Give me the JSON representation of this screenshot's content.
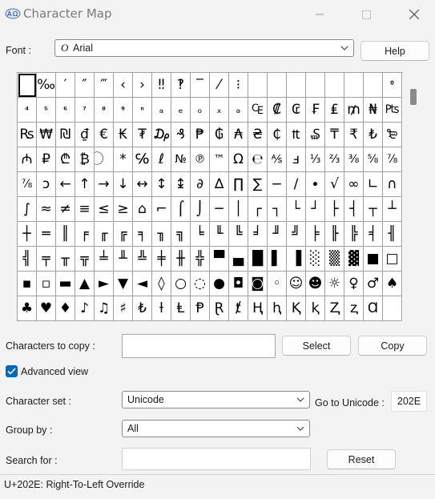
{
  "window": {
    "title": "Character Map"
  },
  "font": {
    "label": "Font :",
    "value": "Arial",
    "icon_glyph": "O"
  },
  "buttons": {
    "help": "Help",
    "select": "Select",
    "copy": "Copy",
    "reset": "Reset"
  },
  "copy_field": {
    "label": "Characters to copy :",
    "value": ""
  },
  "advanced": {
    "label": "Advanced view",
    "checked": true
  },
  "charset": {
    "label": "Character set :",
    "value": "Unicode"
  },
  "goto_unicode": {
    "label": "Go to Unicode :",
    "value": "202E"
  },
  "group_by": {
    "label": "Group by :",
    "value": "All"
  },
  "search": {
    "label": "Search for :",
    "value": ""
  },
  "status": "U+202E: Right-To-Left Override",
  "grid_rows": [
    [
      "",
      "‰",
      "′",
      "″",
      "‴",
      "‹",
      "›",
      "‼",
      "‽",
      "‾",
      "⁄",
      "⁝",
      "",
      "",
      "",
      "",
      "",
      "",
      "",
      "⁰"
    ],
    [
      "⁴",
      "⁵",
      "⁶",
      "⁷",
      "⁸",
      "⁹",
      "ⁿ",
      "ₐ",
      "ₑ",
      "ₒ",
      "ₓ",
      "ₔ",
      "₠",
      "₡",
      "₢",
      "₣",
      "₤",
      "₥",
      "₦",
      "₧"
    ],
    [
      "₨",
      "₩",
      "₪",
      "₫",
      "€",
      "₭",
      "₮",
      "₯",
      "₰",
      "₱",
      "₲",
      "₳",
      "₴",
      "₵",
      "₶",
      "₷",
      "₸",
      "₹",
      "₺",
      "₻"
    ],
    [
      "₼",
      "₽",
      "₾",
      "₿",
      "⃝",
      "*",
      "℅",
      "ℓ",
      "№",
      "℗",
      "™",
      "Ω",
      "℮",
      "⅍",
      "ⅎ",
      "⅓",
      "⅔",
      "⅜",
      "⅝",
      "⅞"
    ],
    [
      "⅞",
      "ↄ",
      "←",
      "↑",
      "→",
      "↓",
      "↔",
      "↕",
      "↨",
      "∂",
      "∆",
      "∏",
      "∑",
      "−",
      "∕",
      "∙",
      "√",
      "∞",
      "∟",
      "∩"
    ],
    [
      "∫",
      "≈",
      "≠",
      "≡",
      "≤",
      "≥",
      "⌂",
      "⌐",
      "⌠",
      "⌡",
      "─",
      "│",
      "┌",
      "┐",
      "└",
      "┘",
      "├",
      "┤",
      "┬",
      "┴"
    ],
    [
      "┼",
      "═",
      "║",
      "╒",
      "╓",
      "╔",
      "╕",
      "╖",
      "╗",
      "╘",
      "╙",
      "╚",
      "╛",
      "╜",
      "╝",
      "╞",
      "╟",
      "╠",
      "╡",
      "╢"
    ],
    [
      "╣",
      "╤",
      "╥",
      "╦",
      "╧",
      "╨",
      "╩",
      "╪",
      "╫",
      "╬",
      "▀",
      "▄",
      "█",
      "▌",
      "▐",
      "░",
      "▒",
      "▓",
      "■",
      "□"
    ],
    [
      "▪",
      "▫",
      "▬",
      "▲",
      "►",
      "▼",
      "◄",
      "◊",
      "○",
      "◌",
      "●",
      "◘",
      "◙",
      "◦",
      "☺",
      "☻",
      "☼",
      "♀",
      "♂",
      "♠"
    ],
    [
      "♣",
      "♥",
      "♦",
      "♪",
      "♫",
      "♯",
      "₺",
      "ƚ",
      "Ⱡ",
      "Ᵽ",
      "Ɽ",
      "ⱦ",
      "Ⱨ",
      "ⱨ",
      "Ⱪ",
      "ⱪ",
      "Ⱬ",
      "ⱬ",
      "Ɑ",
      ""
    ]
  ],
  "colors": {
    "accent": "#0067c0",
    "background": "#f3f3f3"
  }
}
